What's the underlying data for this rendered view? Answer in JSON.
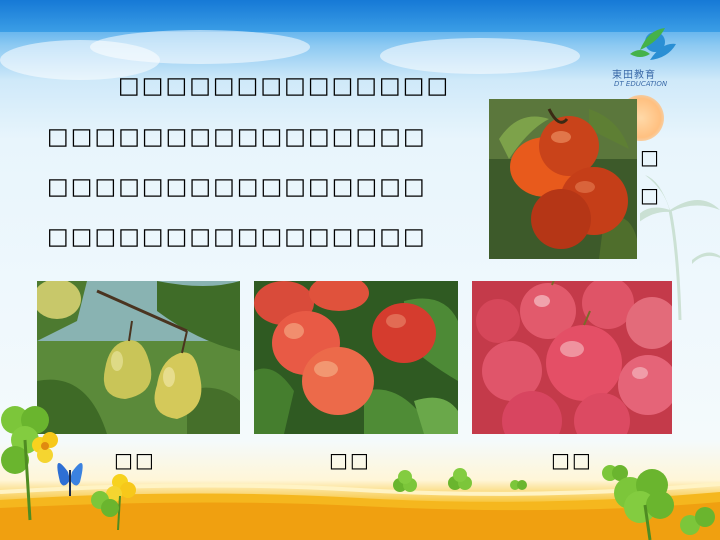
{
  "logo": {
    "name_cn": "東田教育",
    "name_en": "DT EDUCATION"
  },
  "text_lines": [
    "□□□□□□□□□□□□□□",
    "□□□□□□□□□□□□□□□□",
    "□□□□□□□□□□□□□□□□",
    "□□□□□□□□□□□□□□□□"
  ],
  "side_chars": [
    "□",
    "□"
  ],
  "photos": [
    {
      "icon": "persimmon-icon",
      "label": ""
    },
    {
      "icon": "pear-icon",
      "label": "□□"
    },
    {
      "icon": "peach-icon",
      "label": "□□"
    },
    {
      "icon": "apple-icon",
      "label": "□□"
    }
  ]
}
